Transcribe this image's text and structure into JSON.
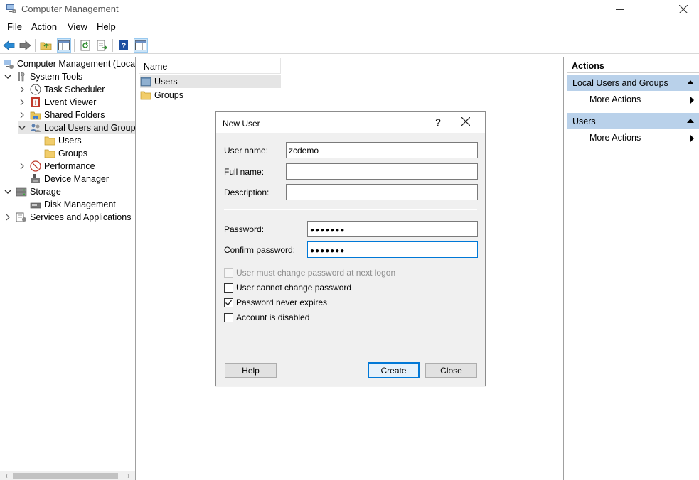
{
  "window": {
    "title": "Computer Management"
  },
  "menu": [
    "File",
    "Action",
    "View",
    "Help"
  ],
  "tree": {
    "root": "Computer Management (Local",
    "system_tools": "System Tools",
    "task_scheduler": "Task Scheduler",
    "event_viewer": "Event Viewer",
    "shared_folders": "Shared Folders",
    "local_users_groups": "Local Users and Groups",
    "users": "Users",
    "groups": "Groups",
    "performance": "Performance",
    "device_manager": "Device Manager",
    "storage": "Storage",
    "disk_management": "Disk Management",
    "services_apps": "Services and Applications"
  },
  "list": {
    "column_name": "Name",
    "items": [
      "Users",
      "Groups"
    ]
  },
  "actions": {
    "title": "Actions",
    "section1": "Local Users and Groups",
    "section1_item": "More Actions",
    "section2": "Users",
    "section2_item": "More Actions"
  },
  "dialog": {
    "title": "New User",
    "help_glyph": "?",
    "username_label": "User name:",
    "username_value": "zcdemo",
    "fullname_label": "Full name:",
    "fullname_value": "",
    "description_label": "Description:",
    "description_value": "",
    "password_label": "Password:",
    "password_value": "●●●●●●●",
    "confirm_label": "Confirm password:",
    "confirm_value": "●●●●●●●",
    "cb_must_change": "User must change password at next logon",
    "cb_cannot_change": "User cannot change password",
    "cb_never_expires": "Password never expires",
    "cb_disabled": "Account is disabled",
    "btn_help": "Help",
    "btn_create": "Create",
    "btn_close": "Close",
    "checks": {
      "must_change": false,
      "cannot_change": false,
      "never_expires": true,
      "disabled": false
    }
  }
}
